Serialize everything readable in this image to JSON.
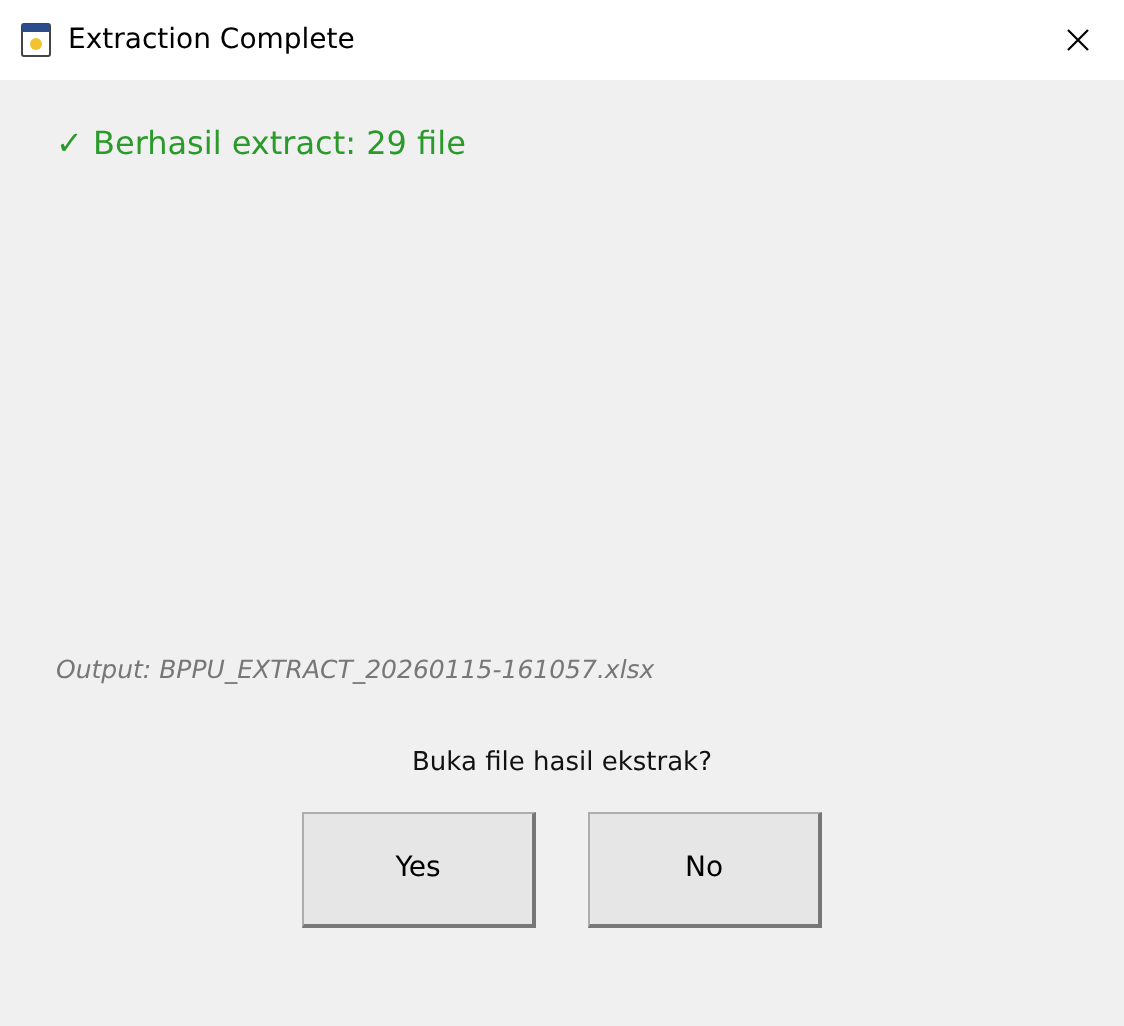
{
  "window": {
    "title": "Extraction Complete"
  },
  "status_message": "✓ Berhasil extract: 29 file",
  "output_path": "Output: BPPU_EXTRACT_20260115-161057.xlsx",
  "question": "Buka file hasil ekstrak?",
  "buttons": [
    {
      "label": "Yes"
    },
    {
      "label": "No"
    }
  ]
}
